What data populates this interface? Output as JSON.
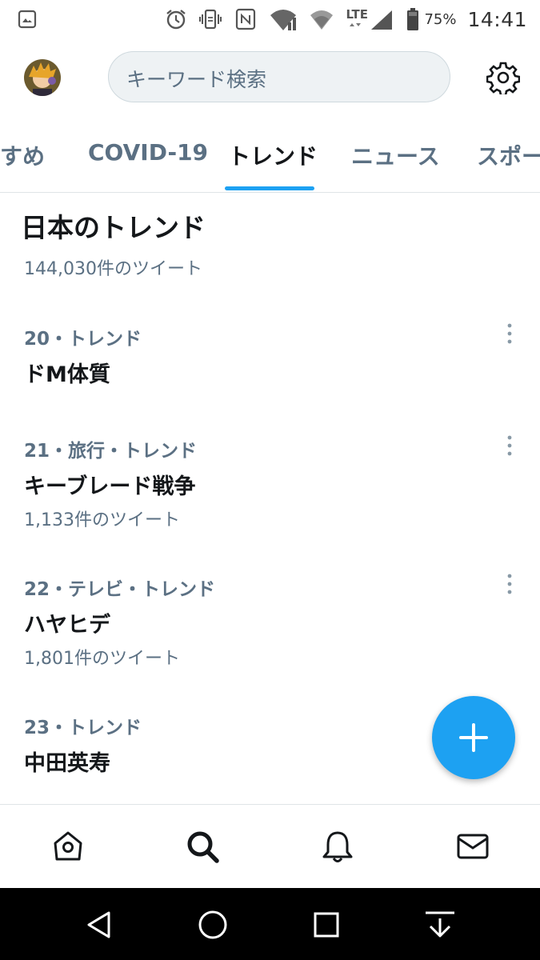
{
  "status_bar": {
    "battery_percent": "75%",
    "time": "14:41",
    "network": "LTE",
    "icons": [
      "screenshot-icon",
      "alarm-icon",
      "vibrate-icon",
      "nfc-icon",
      "wifi-icon",
      "wifi-icon",
      "signal-icon",
      "battery-icon"
    ]
  },
  "header": {
    "search_placeholder": "キーワード検索",
    "avatar": "profile-avatar",
    "settings_icon": "gear-icon"
  },
  "tabs": [
    {
      "label": "すすめ",
      "active": false
    },
    {
      "label": "COVID-19",
      "active": false
    },
    {
      "label": "トレンド",
      "active": true
    },
    {
      "label": "ニュース",
      "active": false
    },
    {
      "label": "スポーツ",
      "active": false
    }
  ],
  "section": {
    "title": "日本のトレンド",
    "subtitle": "144,030件のツイート"
  },
  "trends": [
    {
      "meta": "20・トレンド",
      "name": "ドM体質",
      "count": ""
    },
    {
      "meta": "21・旅行・トレンド",
      "name": "キーブレード戦争",
      "count": "1,133件のツイート"
    },
    {
      "meta": "22・テレビ・トレンド",
      "name": "ハヤヒデ",
      "count": "1,801件のツイート"
    },
    {
      "meta": "23・トレンド",
      "name": "中田英寿",
      "count": ""
    }
  ],
  "fab": {
    "icon": "plus-icon"
  },
  "bottom_nav": [
    "home-icon",
    "search-icon",
    "bell-icon",
    "mail-icon"
  ],
  "system_nav": [
    "back-icon",
    "home-circle-icon",
    "recents-icon",
    "notification-pull-icon"
  ],
  "colors": {
    "accent": "#1da1f2",
    "text_primary": "#14171a",
    "text_secondary": "#5b7083",
    "divider": "#dfe4e7"
  }
}
